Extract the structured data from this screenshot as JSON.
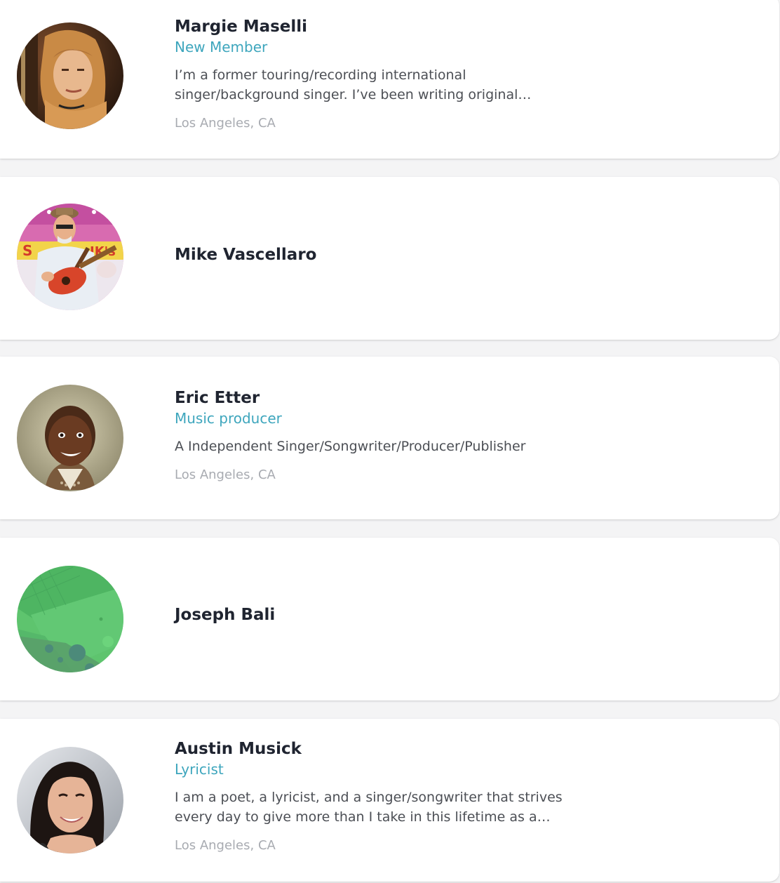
{
  "members": [
    {
      "name": "Margie Maselli",
      "role": "New Member",
      "bio": "I’m a former touring/recording international singer/background singer. I’ve been writing original…",
      "location": "Los Angeles, CA",
      "avatar_icon": "portrait-photo-blonde-woman-with-guitar"
    },
    {
      "name": "Mike Vascellaro",
      "avatar_icon": "portrait-photo-man-playing-guitar"
    },
    {
      "name": "Eric Etter",
      "role": "Music producer",
      "bio": "A Independent Singer/Songwriter/Producer/Publisher",
      "location": "Los Angeles, CA",
      "avatar_icon": "portrait-photo-child"
    },
    {
      "name": "Joseph Bali",
      "avatar_icon": "default-green-pattern-avatar"
    },
    {
      "name": "Austin Musick",
      "role": "Lyricist",
      "bio": "I am a poet, a lyricist, and a singer/songwriter that strives every day to give more than I take in this lifetime as a…",
      "location": "Los Angeles, CA",
      "avatar_icon": "portrait-photo-dark-haired-woman"
    }
  ]
}
